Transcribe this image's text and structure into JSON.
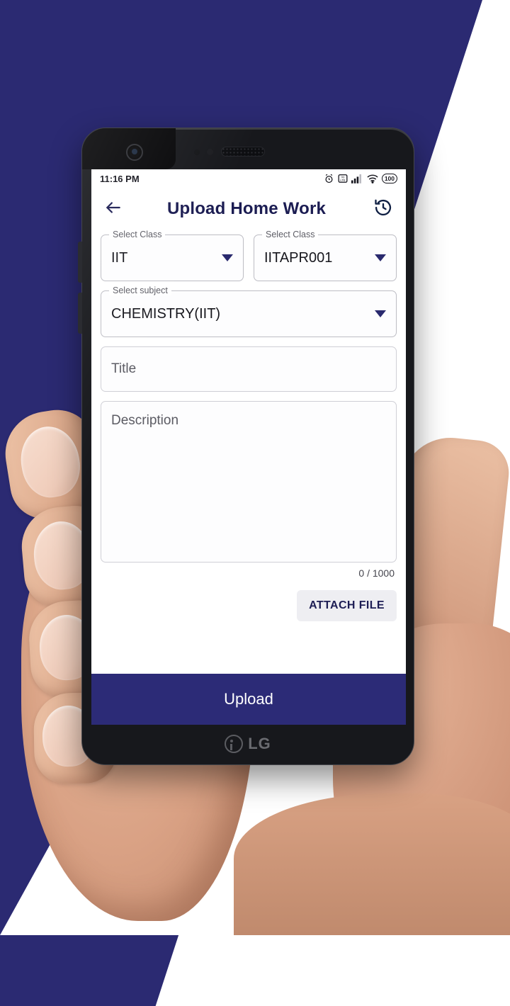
{
  "background": {
    "accent_color": "#2b2a72",
    "base_color": "#ffffff"
  },
  "device": {
    "brand": "LG",
    "body_color": "#17181c"
  },
  "status_bar": {
    "time": "11:16 PM",
    "icons": [
      "alarm-icon",
      "volte-icon",
      "signal-icon",
      "wifi-icon",
      "battery-icon"
    ],
    "battery_level": "100"
  },
  "app_bar": {
    "back_icon": "arrow-left-icon",
    "title": "Upload Home Work",
    "history_icon": "history-icon",
    "title_color": "#1b1c52"
  },
  "form": {
    "class_field": {
      "label": "Select Class",
      "value": "IIT",
      "caret_icon": "chevron-down-icon"
    },
    "batch_field": {
      "label": "Select Class",
      "value": "IITAPR001",
      "caret_icon": "chevron-down-icon"
    },
    "subject_field": {
      "label": "Select subject",
      "value": "CHEMISTRY(IIT)",
      "caret_icon": "chevron-down-icon"
    },
    "title_field": {
      "placeholder": "Title",
      "value": ""
    },
    "description_field": {
      "placeholder": "Description",
      "value": "",
      "counter": "0 / 1000",
      "max_length": 1000
    },
    "attach_button": {
      "label": "ATTACH FILE",
      "text_color": "#1d1d54",
      "background": "#eeeef2"
    }
  },
  "footer": {
    "upload_label": "Upload",
    "background": "#2c2b77",
    "text_color": "#ffffff"
  }
}
